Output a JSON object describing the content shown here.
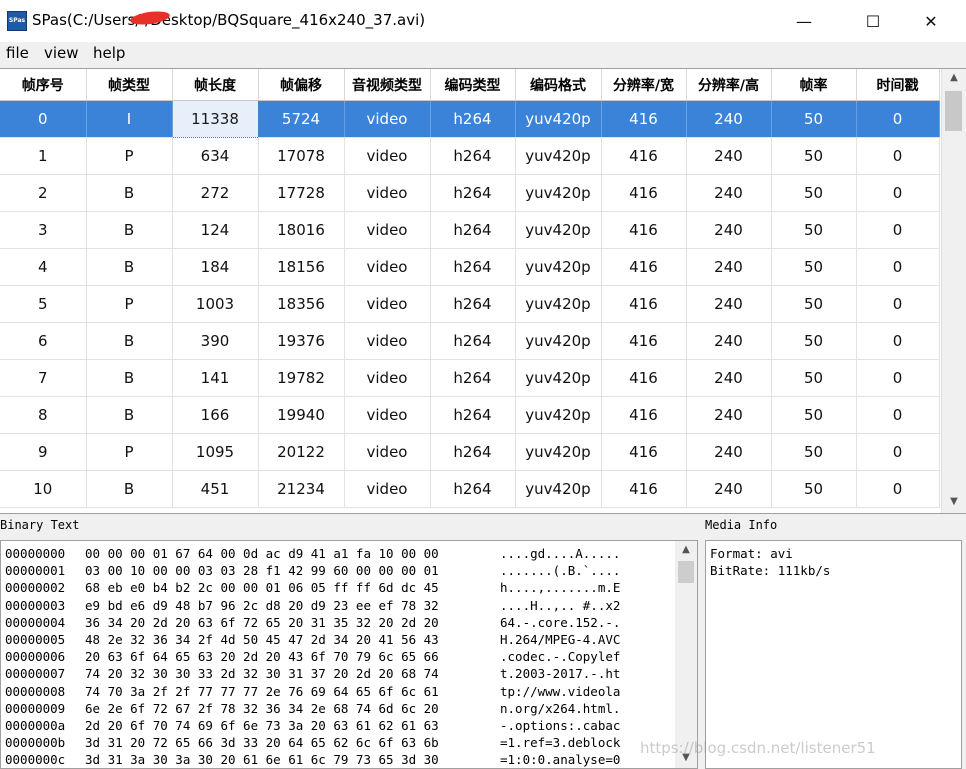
{
  "window": {
    "app_icon_label": "SPas",
    "title": "SPas(C:/Users/      /Desktop/BQSquare_416x240_37.avi)",
    "minimize_glyph": "—",
    "maximize_glyph": "☐",
    "close_glyph": "✕",
    "redaction_color": "#e8302a"
  },
  "menu": [
    "file",
    "view",
    "help"
  ],
  "table": {
    "columns": [
      "帧序号",
      "帧类型",
      "帧长度",
      "帧偏移",
      "音视频类型",
      "编码类型",
      "编码格式",
      "分辨率/宽",
      "分辨率/高",
      "帧率",
      "时间戳"
    ],
    "selected_row": 0,
    "selection_color": "#3a83d9",
    "rows": [
      [
        "0",
        "I",
        "11338",
        "5724",
        "video",
        "h264",
        "yuv420p",
        "416",
        "240",
        "50",
        "0"
      ],
      [
        "1",
        "P",
        "634",
        "17078",
        "video",
        "h264",
        "yuv420p",
        "416",
        "240",
        "50",
        "0"
      ],
      [
        "2",
        "B",
        "272",
        "17728",
        "video",
        "h264",
        "yuv420p",
        "416",
        "240",
        "50",
        "0"
      ],
      [
        "3",
        "B",
        "124",
        "18016",
        "video",
        "h264",
        "yuv420p",
        "416",
        "240",
        "50",
        "0"
      ],
      [
        "4",
        "B",
        "184",
        "18156",
        "video",
        "h264",
        "yuv420p",
        "416",
        "240",
        "50",
        "0"
      ],
      [
        "5",
        "P",
        "1003",
        "18356",
        "video",
        "h264",
        "yuv420p",
        "416",
        "240",
        "50",
        "0"
      ],
      [
        "6",
        "B",
        "390",
        "19376",
        "video",
        "h264",
        "yuv420p",
        "416",
        "240",
        "50",
        "0"
      ],
      [
        "7",
        "B",
        "141",
        "19782",
        "video",
        "h264",
        "yuv420p",
        "416",
        "240",
        "50",
        "0"
      ],
      [
        "8",
        "B",
        "166",
        "19940",
        "video",
        "h264",
        "yuv420p",
        "416",
        "240",
        "50",
        "0"
      ],
      [
        "9",
        "P",
        "1095",
        "20122",
        "video",
        "h264",
        "yuv420p",
        "416",
        "240",
        "50",
        "0"
      ],
      [
        "10",
        "B",
        "451",
        "21234",
        "video",
        "h264",
        "yuv420p",
        "416",
        "240",
        "50",
        "0"
      ]
    ]
  },
  "binary_panel": {
    "label": "Binary Text",
    "lines": [
      {
        "offset": "00000000",
        "bytes": "00 00 00 01 67 64 00 0d ac d9 41 a1 fa 10 00 00",
        "ascii": "....gd....A....."
      },
      {
        "offset": "00000001",
        "bytes": "03 00 10 00 00 03 03 28 f1 42 99 60 00 00 00 01",
        "ascii": ".......(.B.`...."
      },
      {
        "offset": "00000002",
        "bytes": "68 eb e0 b4 b2 2c 00 00 01 06 05 ff ff 6d dc 45",
        "ascii": "h....,.......m.E"
      },
      {
        "offset": "00000003",
        "bytes": "e9 bd e6 d9 48 b7 96 2c d8 20 d9 23 ee ef 78 32",
        "ascii": "....H..,.. #..x2"
      },
      {
        "offset": "00000004",
        "bytes": "36 34 20 2d 20 63 6f 72 65 20 31 35 32 20 2d 20",
        "ascii": "64.-.core.152.-."
      },
      {
        "offset": "00000005",
        "bytes": "48 2e 32 36 34 2f 4d 50 45 47 2d 34 20 41 56 43",
        "ascii": "H.264/MPEG-4.AVC"
      },
      {
        "offset": "00000006",
        "bytes": "20 63 6f 64 65 63 20 2d 20 43 6f 70 79 6c 65 66",
        "ascii": ".codec.-.Copylef"
      },
      {
        "offset": "00000007",
        "bytes": "74 20 32 30 30 33 2d 32 30 31 37 20 2d 20 68 74",
        "ascii": "t.2003-2017.-.ht"
      },
      {
        "offset": "00000008",
        "bytes": "74 70 3a 2f 2f 77 77 77 2e 76 69 64 65 6f 6c 61",
        "ascii": "tp://www.videola"
      },
      {
        "offset": "00000009",
        "bytes": "6e 2e 6f 72 67 2f 78 32 36 34 2e 68 74 6d 6c 20",
        "ascii": "n.org/x264.html."
      },
      {
        "offset": "0000000a",
        "bytes": "2d 20 6f 70 74 69 6f 6e 73 3a 20 63 61 62 61 63",
        "ascii": "-.options:.cabac"
      },
      {
        "offset": "0000000b",
        "bytes": "3d 31 20 72 65 66 3d 33 20 64 65 62 6c 6f 63 6b",
        "ascii": "=1.ref=3.deblock"
      },
      {
        "offset": "0000000c",
        "bytes": "3d 31 3a 30 3a 30 20 61 6e 61 6c 79 73 65 3d 30",
        "ascii": "=1:0:0.analyse=0"
      }
    ]
  },
  "media_panel": {
    "label": "Media Info",
    "lines": [
      "Format: avi",
      "BitRate: 111kb/s"
    ]
  },
  "watermark": "https://blog.csdn.net/listener51"
}
